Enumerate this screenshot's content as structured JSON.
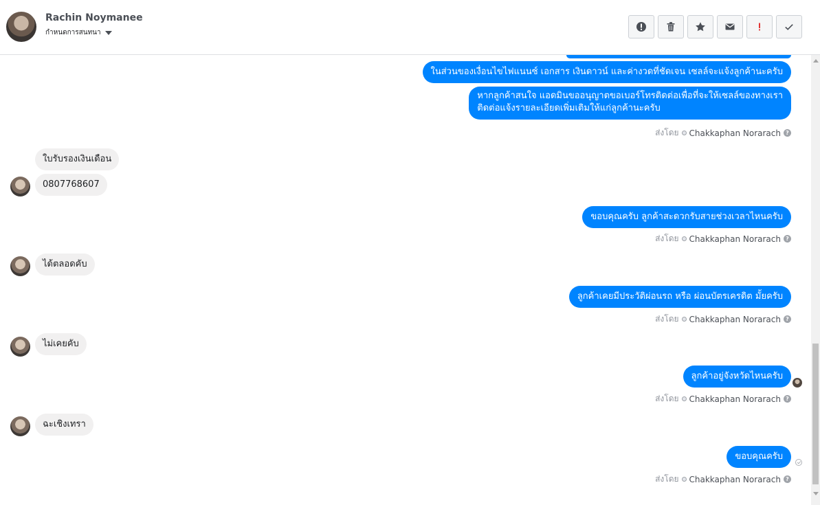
{
  "contact": {
    "name": "Rachin Noymanee",
    "assign_label": "กำหนดการสนทนา"
  },
  "actions": [
    {
      "icon": "alert-circle-icon"
    },
    {
      "icon": "trash-icon"
    },
    {
      "icon": "star-icon"
    },
    {
      "icon": "envelope-icon"
    },
    {
      "icon": "exclamation-icon"
    },
    {
      "icon": "check-icon"
    }
  ],
  "messages": {
    "out1": "ในส่วนของเงื่อนไขไฟแนนซ์ เอกสาร เงินดาวน์ และค่างวดที่ชัดเจน เซลล์จะแจ้งลูกค้านะครับ",
    "out2_line1": "หากลูกค้าสนใจ แอดมินขออนุญาตขอเบอร์โทรติดต่อเพื่อที่จะให้เซลล์ของทางเรา",
    "out2_line2": "ติดต่อแจ้งรายละเอียดเพิ่มเติมให้แก่ลูกค้านะครับ",
    "in1": "ใบรับรองเงินเดือน",
    "in2": "0807768607",
    "out3": "ขอบคุณครับ ลูกค้าสะดวกรับสายช่วงเวลาไหนครับ",
    "in3": "ได้ตลอดคับ",
    "out4": "ลูกค้าเคยมีประวัติผ่อนรถ หรือ ผ่อนบัตรเครดิต มั้ยครับ",
    "in4": "ไม่เคยคับ",
    "out5": "ลูกค้าอยู่จังหวัดไหนครับ",
    "in5": "ฉะเชิงเทรา",
    "out6": "ขอบคุณครับ"
  },
  "sent_by": {
    "prefix": "ส่งโดย",
    "agent": "Chakkaphan Norarach",
    "help": "?"
  },
  "colors": {
    "outgoing": "#0084ff",
    "incoming": "#f1f0f0",
    "meta": "#90949c"
  }
}
